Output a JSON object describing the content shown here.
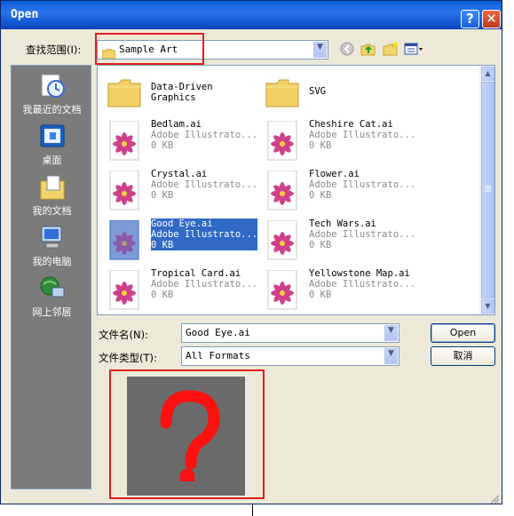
{
  "title": "Open",
  "title_buttons": {
    "help": "?",
    "close": "✕"
  },
  "look_in": {
    "label": "查找范围(I):",
    "value": "Sample Art"
  },
  "toolbar_icons": [
    "back-icon",
    "up-folder-icon",
    "new-folder-icon",
    "view-menu-icon"
  ],
  "places": [
    {
      "label": "我最近的文档",
      "icon": "recent-documents-icon"
    },
    {
      "label": "桌面",
      "icon": "desktop-icon"
    },
    {
      "label": "我的文档",
      "icon": "my-documents-icon"
    },
    {
      "label": "我的电脑",
      "icon": "my-computer-icon"
    },
    {
      "label": "网上邻居",
      "icon": "network-places-icon"
    }
  ],
  "files": [
    {
      "name": "Data-Driven",
      "name2": "Graphics",
      "type": "",
      "size": "",
      "kind": "folder"
    },
    {
      "name": "SVG",
      "name2": "",
      "type": "",
      "size": "",
      "kind": "folder"
    },
    {
      "name": "Bedlam.ai",
      "type": "Adobe Illustrato...",
      "size": "0 KB",
      "kind": "ai"
    },
    {
      "name": "Cheshire Cat.ai",
      "type": "Adobe Illustrato...",
      "size": "0 KB",
      "kind": "ai"
    },
    {
      "name": "Crystal.ai",
      "type": "Adobe Illustrato...",
      "size": "0 KB",
      "kind": "ai"
    },
    {
      "name": "Flower.ai",
      "type": "Adobe Illustrato...",
      "size": "0 KB",
      "kind": "ai"
    },
    {
      "name": "Good Eye.ai",
      "type": "Adobe Illustrato...",
      "size": "0 KB",
      "kind": "ai",
      "selected": true
    },
    {
      "name": "Tech Wars.ai",
      "type": "Adobe Illustrato...",
      "size": "0 KB",
      "kind": "ai"
    },
    {
      "name": "Tropical Card.ai",
      "type": "Adobe Illustrato...",
      "size": "0 KB",
      "kind": "ai"
    },
    {
      "name": "Yellowstone Map.ai",
      "type": "Adobe Illustrato...",
      "size": "0 KB",
      "kind": "ai"
    }
  ],
  "filename": {
    "label": "文件名(N):",
    "value": "Good Eye.ai"
  },
  "filetype": {
    "label": "文件类型(T):",
    "value": "All Formats"
  },
  "buttons": {
    "open": "Open",
    "cancel": "取消"
  },
  "preview": {
    "glyph": "?"
  },
  "colors": {
    "title_bar": "#1254d0",
    "selection": "#316ac5",
    "highlight_box": "#e01e1e",
    "preview_bg": "#6a6a6a",
    "question_mark": "#ff1010"
  }
}
